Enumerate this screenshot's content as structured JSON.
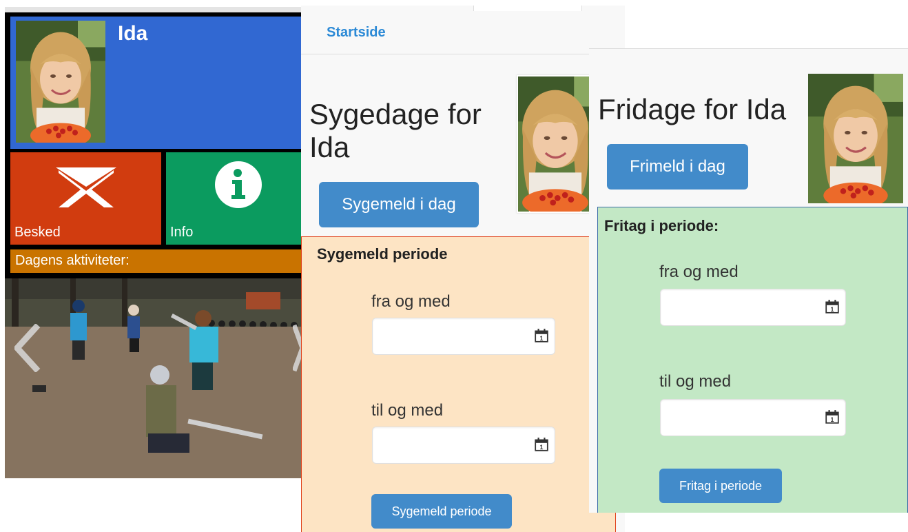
{
  "home": {
    "child_name": "Ida",
    "tiles": {
      "message_label": "Besked",
      "info_label": "Info",
      "activities_label": "Dagens aktiviteter:"
    },
    "colors": {
      "profile": "#3168d2",
      "message": "#d13c0f",
      "info": "#0b9b5f",
      "activities": "#c97300"
    }
  },
  "sick": {
    "nav_link": "Startside",
    "title": "Sygedage for Ida",
    "today_button": "Sygemeld i dag",
    "period": {
      "title": "Sygemeld periode",
      "from_label": "fra og med",
      "to_label": "til og med",
      "from_value": "",
      "to_value": "",
      "submit_label": "Sygemeld periode"
    },
    "colors": {
      "period_bg": "#fde4c4",
      "period_border": "#e0411a"
    }
  },
  "dayoff": {
    "title": "Fridage for Ida",
    "today_button": "Frimeld i dag",
    "period": {
      "title": "Fritag i periode:",
      "from_label": "fra og med",
      "to_label": "til og med",
      "from_value": "",
      "to_value": "",
      "submit_label": "Fritag i periode"
    },
    "colors": {
      "period_bg": "#c3e8c5",
      "period_border": "#3a6aa8"
    }
  },
  "icons": [
    "envelope-icon",
    "info-icon",
    "calendar-icon",
    "chevron-left-icon",
    "chevron-right-icon"
  ]
}
